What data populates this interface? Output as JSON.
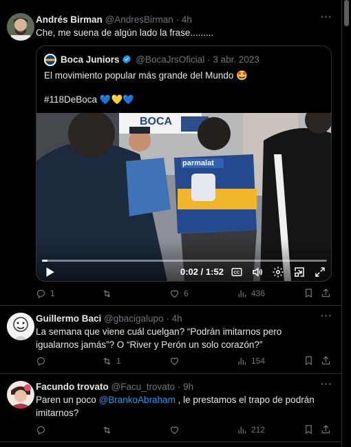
{
  "colors": {
    "background": "#000000",
    "text": "#e7e9ea",
    "muted": "#71767b",
    "link": "#1d9bf0",
    "border": "#2f3336",
    "verified": "#1d9bf0"
  },
  "posts": [
    {
      "display_name": "Andrés Birman",
      "handle": "@AndresBirman",
      "sep": "·",
      "time": "4h",
      "text": "Che, me suena de algún lado la frase.........",
      "quote": {
        "display_name": "Boca Juniors",
        "handle": "@BocaJrsOficial",
        "sep": "·",
        "date": "3 abr. 2023",
        "line1": "El movimiento popular más grande del Mundo 🤩",
        "line2": "#118DeBoca 💙💛💙",
        "video": {
          "elapsed": "0:02",
          "divider": "/",
          "duration": "1:52",
          "progress": 0.02,
          "jersey_sponsor": "parmalat",
          "sign_text": "BOCA"
        }
      },
      "actions": {
        "reply": "1",
        "repost": "",
        "like": "6",
        "views": "436"
      }
    },
    {
      "display_name": "Guillermo Baci",
      "handle": "@gbacigalupo",
      "sep": "·",
      "time": "4h",
      "text": "La semana que viene cuál cuelgan? “Podrán imitarnos pero igualarnos jamás”? O “River y Perón un solo corazón?”",
      "actions": {
        "reply": "",
        "repost": "1",
        "like": "",
        "views": "154"
      }
    },
    {
      "display_name": "Facundo trovato",
      "handle": "@Facu_trovato",
      "sep": "·",
      "time": "9h",
      "text_before": "Paren un poco ",
      "mention": "@BrankoAbraham",
      "text_after": " , le prestamos el trapo de podrán imitarnos?",
      "actions": {
        "reply": "",
        "repost": "",
        "like": "",
        "views": "212"
      }
    }
  ],
  "icons": [
    "more-icon",
    "reply-icon",
    "repost-icon",
    "like-icon",
    "views-icon",
    "bookmark-icon",
    "share-icon",
    "play-icon",
    "captions-icon",
    "volume-icon",
    "settings-icon",
    "pip-icon",
    "fullscreen-icon",
    "verified-badge-icon"
  ]
}
